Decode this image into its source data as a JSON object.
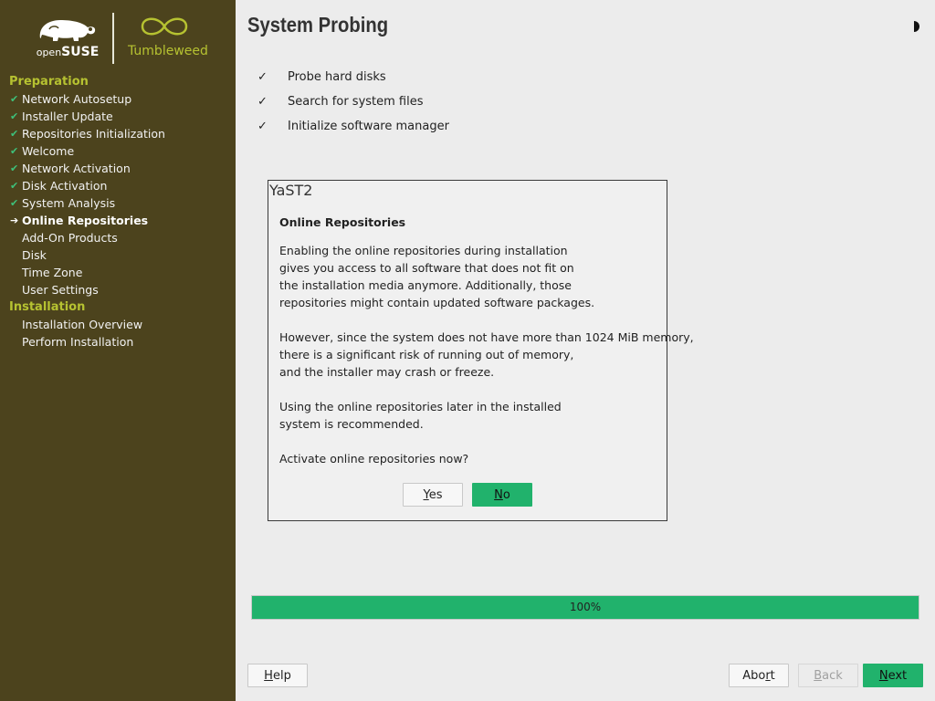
{
  "logos": {
    "opensuse_open": "open",
    "opensuse_suse": "SUSE",
    "tumbleweed": "Tumbleweed"
  },
  "sidebar": {
    "sections": [
      {
        "title": "Preparation",
        "items": [
          {
            "label": "Network Autosetup",
            "status": "done"
          },
          {
            "label": "Installer Update",
            "status": "done"
          },
          {
            "label": "Repositories Initialization",
            "status": "done"
          },
          {
            "label": "Welcome",
            "status": "done"
          },
          {
            "label": "Network Activation",
            "status": "done"
          },
          {
            "label": "Disk Activation",
            "status": "done"
          },
          {
            "label": "System Analysis",
            "status": "done"
          },
          {
            "label": "Online Repositories",
            "status": "current"
          },
          {
            "label": "Add-On Products",
            "status": "pending"
          },
          {
            "label": "Disk",
            "status": "pending"
          },
          {
            "label": "Time Zone",
            "status": "pending"
          },
          {
            "label": "User Settings",
            "status": "pending"
          }
        ]
      },
      {
        "title": "Installation",
        "items": [
          {
            "label": "Installation Overview",
            "status": "pending"
          },
          {
            "label": "Perform Installation",
            "status": "pending"
          }
        ]
      }
    ],
    "done_mark": "✔",
    "current_mark": "➔"
  },
  "main": {
    "title": "System Probing",
    "probe_mark": "✓",
    "probes": [
      "Probe hard disks",
      "Search for system files",
      "Initialize software manager"
    ]
  },
  "dialog": {
    "window_title": "YaST2",
    "heading": "Online Repositories",
    "lines": [
      "Enabling the online repositories during installation",
      "gives you access to all software that does not fit on",
      "the installation media anymore. Additionally, those",
      "repositories might contain updated software packages.",
      "",
      "However, since the system does not have more than 1024 MiB memory,",
      "there is a significant risk of running out of memory,",
      "and the installer may crash or freeze.",
      "",
      "Using the online repositories later in the installed",
      "system is recommended.",
      "",
      "Activate online repositories now?"
    ],
    "yes_label": "Yes",
    "no_label": "No"
  },
  "progress": {
    "value": 100,
    "label": "100%"
  },
  "footer": {
    "help_label": "Help",
    "abort_label": "Abort",
    "back_label": "Back",
    "next_label": "Next"
  },
  "colors": {
    "sidebar_bg": "#4c431d",
    "accent_green": "#21b26c",
    "section_title": "#b6c231"
  },
  "icons": {
    "theme_toggle": "half-moon-icon",
    "done": "check-icon",
    "current": "arrow-right-icon"
  }
}
